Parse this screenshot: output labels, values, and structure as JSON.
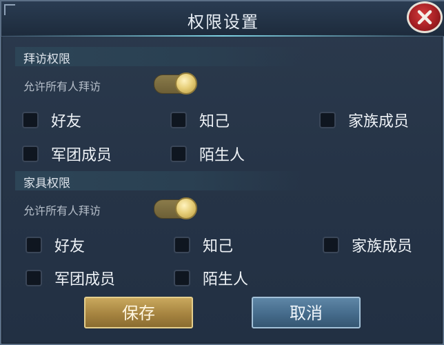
{
  "dialog": {
    "title": "权限设置",
    "close_icon": "close-icon"
  },
  "sections": [
    {
      "header": "拜访权限",
      "toggle_label": "允许所有人拜访",
      "toggle_on": true,
      "options": [
        "好友",
        "知己",
        "家族成员",
        "军团成员",
        "陌生人"
      ]
    },
    {
      "header": "家具权限",
      "toggle_label": "允许所有人拜访",
      "toggle_on": true,
      "options": [
        "好友",
        "知己",
        "家族成员",
        "军团成员",
        "陌生人"
      ]
    }
  ],
  "buttons": {
    "save": "保存",
    "cancel": "取消"
  },
  "colors": {
    "save_button": "#a68440",
    "cancel_button": "#456b8b",
    "close_button": "#a51f23"
  }
}
